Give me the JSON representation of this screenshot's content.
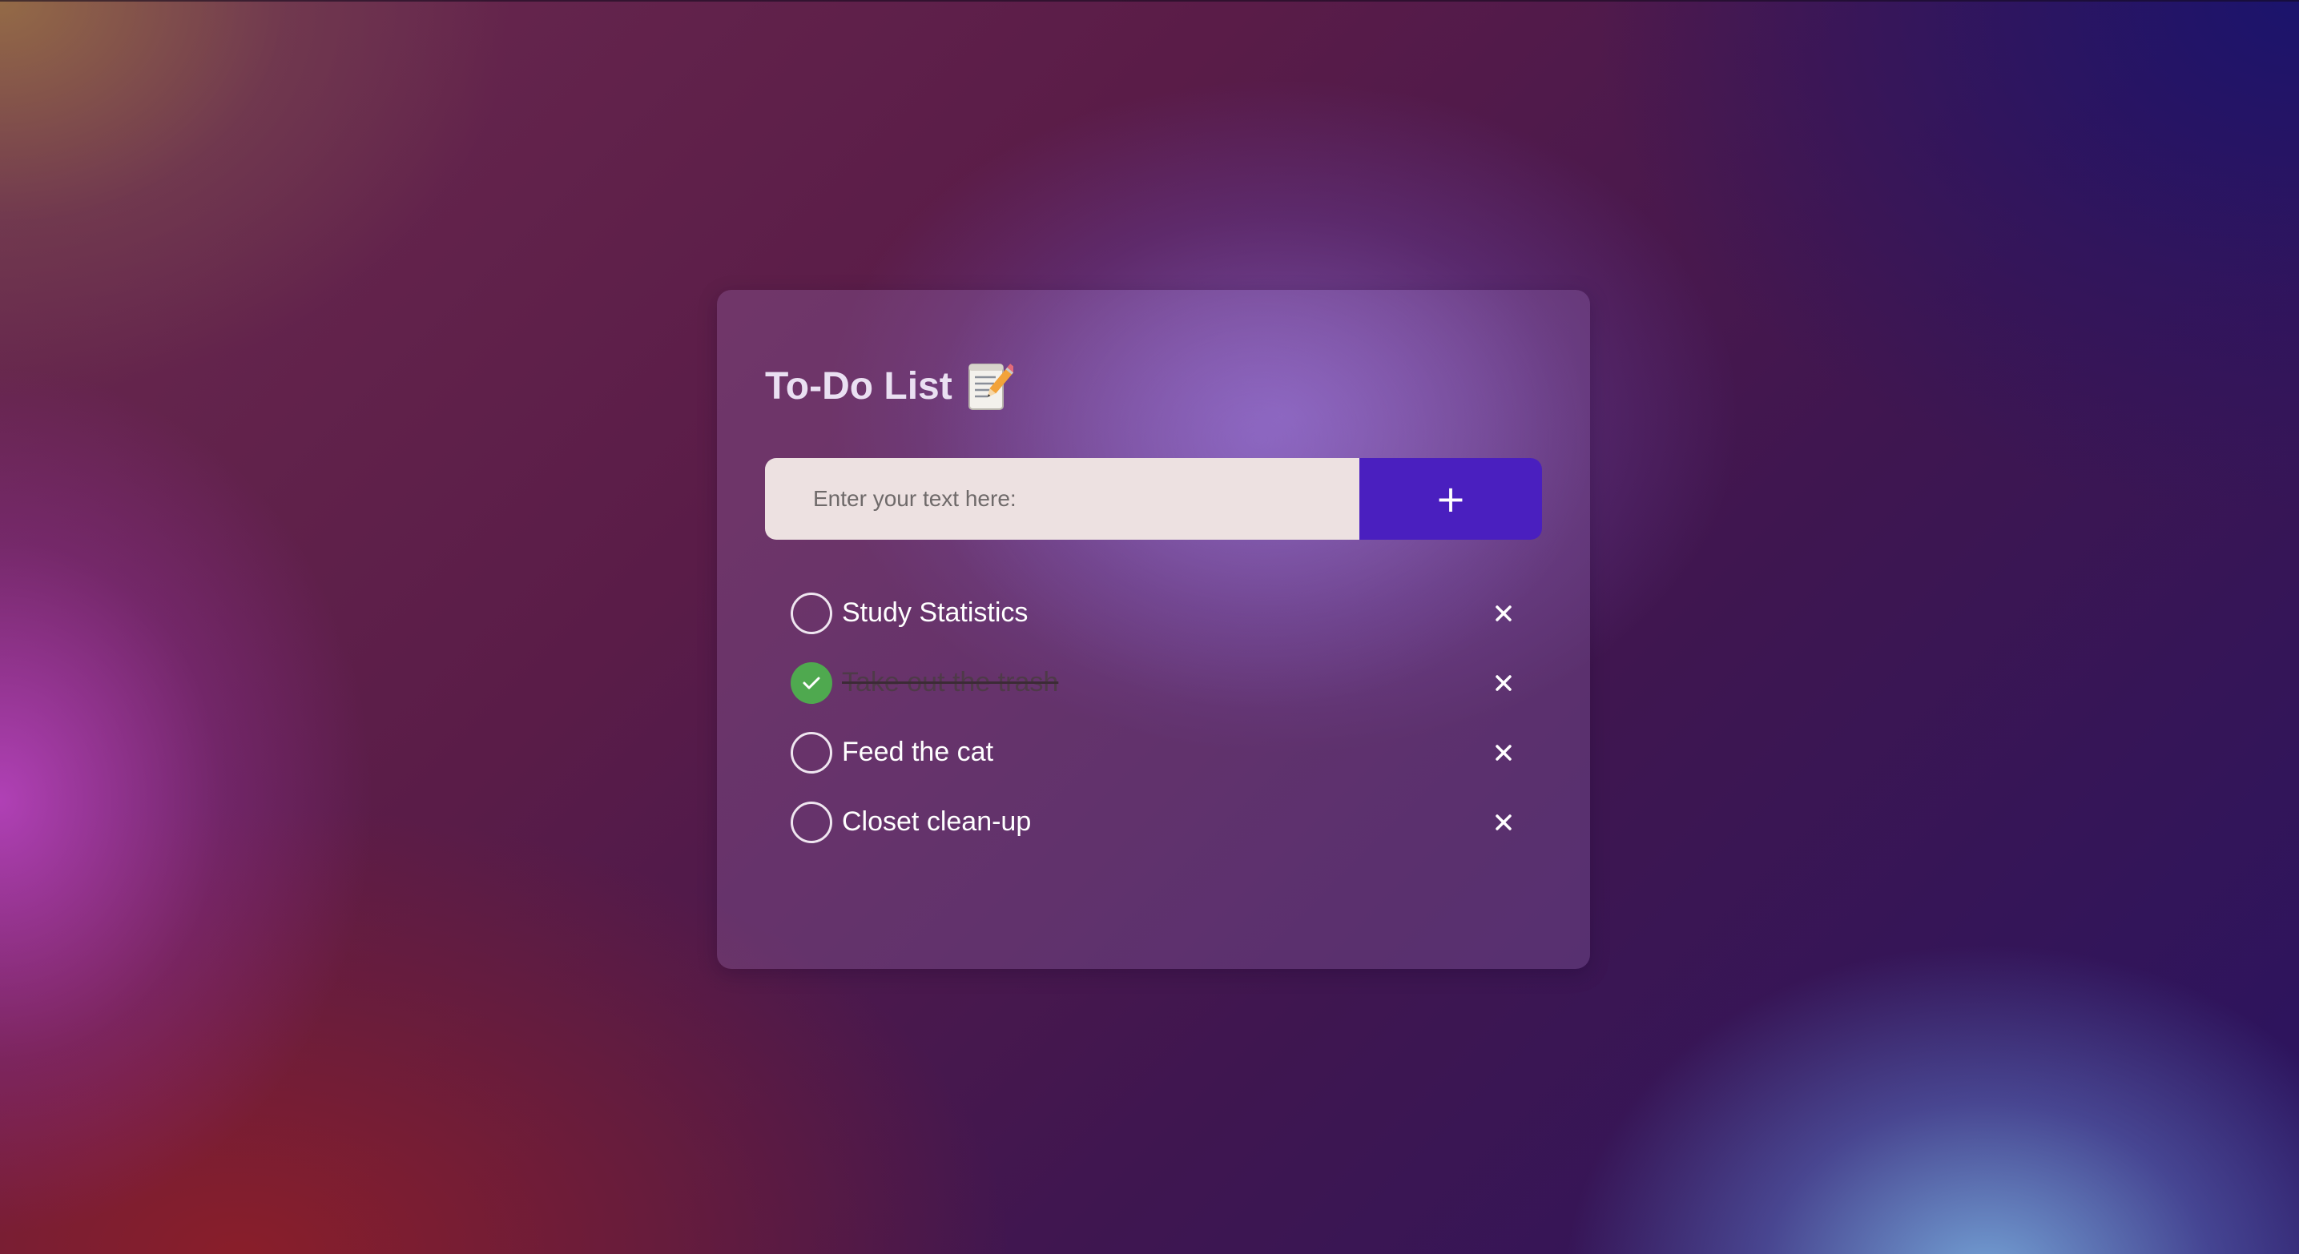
{
  "app": {
    "title": "To-Do List"
  },
  "input": {
    "placeholder": "Enter your text here:",
    "value": ""
  },
  "add_button": {
    "label": "+"
  },
  "todos": [
    {
      "label": "Study Statistics",
      "done": false
    },
    {
      "label": "Take out the trash",
      "done": true
    },
    {
      "label": "Feed the cat",
      "done": false
    },
    {
      "label": "Closet clean-up",
      "done": false
    }
  ],
  "icons": {
    "title_icon": "memo-icon",
    "done_icon": "check-icon",
    "delete_icon": "close-icon"
  },
  "colors": {
    "accent": "#4a1fbf",
    "done": "#4fa94f",
    "input_bg": "#ede1e1"
  }
}
